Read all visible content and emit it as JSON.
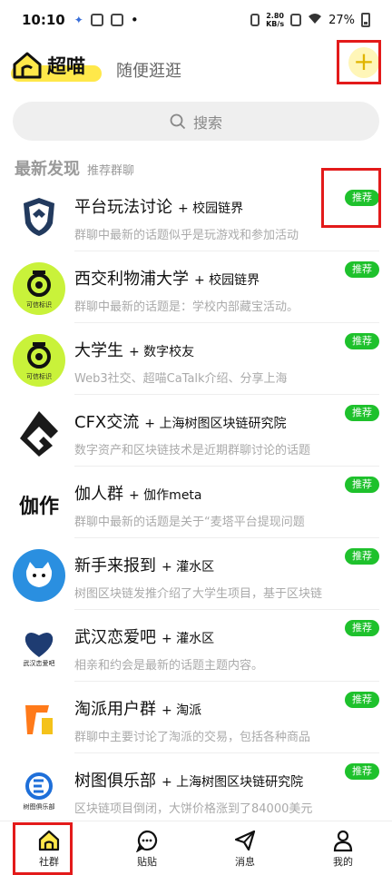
{
  "status_bar": {
    "time": "10:10",
    "net_speed_top": "2.80",
    "net_speed_bottom": "KB/s",
    "battery": "27%"
  },
  "header": {
    "brand": "超喵",
    "tab_browse": "随便逛逛",
    "plus": "+"
  },
  "search": {
    "placeholder": "搜索"
  },
  "section": {
    "title": "最新发现",
    "subtitle": "推荐群聊"
  },
  "badge_label": "推荐",
  "groups": [
    {
      "name": "平台玩法讨论",
      "tag": "+ 校园链界",
      "desc": "群聊中最新的话题似乎是玩游戏和参加活动",
      "avatar": "shield-logo"
    },
    {
      "name": "西交利物浦大学",
      "tag": "+ 校园链界",
      "desc": "群聊中最新的话题是：学校内部藏宝活动。",
      "avatar": "trust-mark",
      "avatar_text": "可信标识"
    },
    {
      "name": "大学生",
      "tag": "+ 数字校友",
      "desc": "Web3社交、超喵CaTalk介绍、分享上海",
      "avatar": "trust-mark",
      "avatar_text": "可信标识"
    },
    {
      "name": "CFX交流",
      "tag": "+ 上海树图区块链研究院",
      "desc": "数字资产和区块链技术是近期群聊讨论的话题",
      "avatar": "cfx-logo"
    },
    {
      "name": "伽人群",
      "tag": "+ 伽作meta",
      "desc": "群聊中最新的话题是关于“麦塔平台提现问题",
      "avatar": "jiazuo-logo",
      "avatar_text": "伽作"
    },
    {
      "name": "新手来报到",
      "tag": "+ 灌水区",
      "desc": "树图区块链发推介绍了大学生项目，基于区块链",
      "avatar": "cat-logo"
    },
    {
      "name": "武汉恋爱吧",
      "tag": "+ 灌水区",
      "desc": "相亲和约会是最新的话题主题内容。",
      "avatar": "heart-logo",
      "avatar_text": "武汉恋爱吧"
    },
    {
      "name": "淘派用户群",
      "tag": "+ 淘派",
      "desc": "群聊中主要讨论了淘派的交易，包括各种商品",
      "avatar": "taopai-logo"
    },
    {
      "name": "树图俱乐部",
      "tag": "+ 上海树图区块链研究院",
      "desc": "区块链项目倒闭，大饼价格涨到了84000美元",
      "avatar": "club-logo",
      "avatar_text": "树图俱乐部"
    }
  ],
  "bottom_nav": [
    {
      "label": "社群",
      "icon": "home-icon"
    },
    {
      "label": "贴贴",
      "icon": "chat-icon"
    },
    {
      "label": "消息",
      "icon": "send-icon"
    },
    {
      "label": "我的",
      "icon": "user-icon"
    }
  ],
  "colors": {
    "accent_yellow": "#ffe84a",
    "badge_green": "#1ec12c",
    "highlight_red": "#e31a1a"
  }
}
